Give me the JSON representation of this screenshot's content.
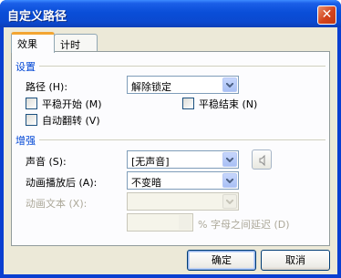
{
  "window": {
    "title": "自定义路径",
    "close_glyph": "✕"
  },
  "tabs": [
    {
      "label": "效果",
      "active": true
    },
    {
      "label": "计时",
      "active": false
    }
  ],
  "settings": {
    "group_label": "设置",
    "path": {
      "label": "路径 (H):",
      "value": "解除锁定"
    },
    "smooth_start": {
      "label": "平稳开始 (M)",
      "checked": false
    },
    "smooth_end": {
      "label": "平稳结束 (N)",
      "checked": false
    },
    "auto_reverse": {
      "label": "自动翻转 (V)",
      "checked": false
    }
  },
  "enhancements": {
    "group_label": "增强",
    "sound": {
      "label": "声音 (S):",
      "value": "[无声音]",
      "icon": "speaker-icon"
    },
    "after_animation": {
      "label": "动画播放后 (A):",
      "value": "不变暗"
    },
    "animate_text": {
      "label": "动画文本 (X):",
      "value": "",
      "enabled": false
    },
    "delay": {
      "value": "",
      "suffix": "% 字母之间延迟 (D)",
      "enabled": false
    }
  },
  "buttons": {
    "ok": "确定",
    "cancel": "取消"
  },
  "colors": {
    "titlebar": "#0a4ed8",
    "group_label": "#0046d5",
    "client_bg": "#ece9d8",
    "active_tab_accent": "#f3a532"
  }
}
